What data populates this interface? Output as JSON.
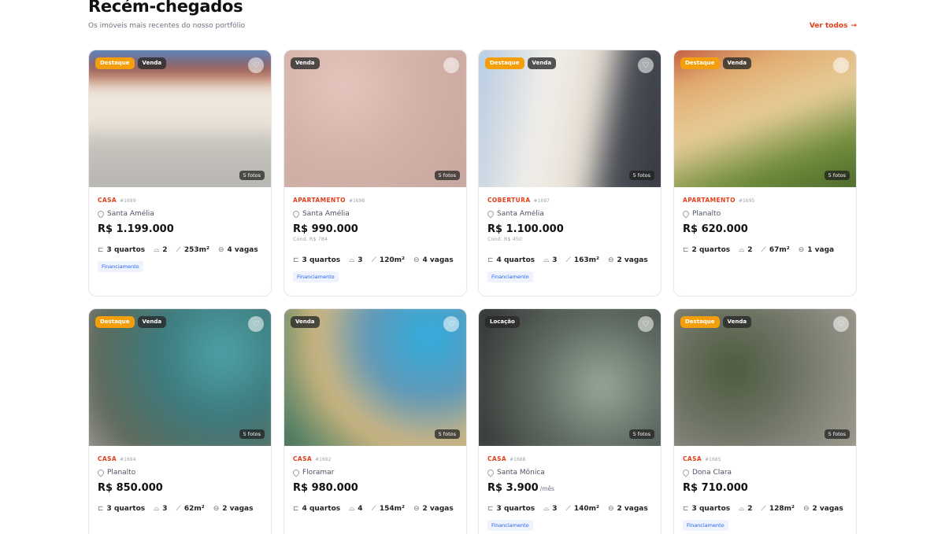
{
  "section": {
    "title": "Recém-chegados",
    "subtitle": "Os imóveis mais recentes do nosso portfólio",
    "see_all": "Ver todos",
    "see_all_icon": "arrow-right-icon"
  },
  "colors": {
    "accent": "#e2401c",
    "badge_featured": "#f59e0b",
    "tag_text": "#2563eb"
  },
  "listings": [
    {
      "badges": [
        "Destaque",
        "Venda"
      ],
      "photos": "5 fotos",
      "type": "CASA",
      "code": "#1699",
      "location": "Santa Amélia",
      "price": "R$ 1.199.000",
      "price_suffix": "",
      "condo": "",
      "bedrooms": "3 quartos",
      "baths": "2",
      "area": "253m²",
      "parking": "4 vagas",
      "tag": "Financiamento"
    },
    {
      "badges": [
        "Venda"
      ],
      "photos": "5 fotos",
      "type": "APARTAMENTO",
      "code": "#1698",
      "location": "Santa Amélia",
      "price": "R$ 990.000",
      "price_suffix": "",
      "condo": "Cond. R$ 784",
      "bedrooms": "3 quartos",
      "baths": "3",
      "area": "120m²",
      "parking": "4 vagas",
      "tag": "Financiamento"
    },
    {
      "badges": [
        "Destaque",
        "Venda"
      ],
      "photos": "5 fotos",
      "type": "COBERTURA",
      "code": "#1697",
      "location": "Santa Amélia",
      "price": "R$ 1.100.000",
      "price_suffix": "",
      "condo": "Cond. R$ 450",
      "bedrooms": "4 quartos",
      "baths": "3",
      "area": "163m²",
      "parking": "2 vagas",
      "tag": "Financiamento"
    },
    {
      "badges": [
        "Destaque",
        "Venda"
      ],
      "photos": "5 fotos",
      "type": "APARTAMENTO",
      "code": "#1695",
      "location": "Planalto",
      "price": "R$ 620.000",
      "price_suffix": "",
      "condo": "",
      "bedrooms": "2 quartos",
      "baths": "2",
      "area": "67m²",
      "parking": "1 vaga",
      "tag": ""
    },
    {
      "badges": [
        "Destaque",
        "Venda"
      ],
      "photos": "5 fotos",
      "type": "CASA",
      "code": "#1694",
      "location": "Planalto",
      "price": "R$ 850.000",
      "price_suffix": "",
      "condo": "",
      "bedrooms": "3 quartos",
      "baths": "3",
      "area": "62m²",
      "parking": "2 vagas",
      "tag": ""
    },
    {
      "badges": [
        "Venda"
      ],
      "photos": "5 fotos",
      "type": "CASA",
      "code": "#1692",
      "location": "Floramar",
      "price": "R$ 980.000",
      "price_suffix": "",
      "condo": "",
      "bedrooms": "4 quartos",
      "baths": "4",
      "area": "154m²",
      "parking": "2 vagas",
      "tag": ""
    },
    {
      "badges": [
        "Locação"
      ],
      "photos": "5 fotos",
      "type": "CASA",
      "code": "#1688",
      "location": "Santa Mônica",
      "price": "R$ 3.900",
      "price_suffix": "/mês",
      "condo": "",
      "bedrooms": "3 quartos",
      "baths": "3",
      "area": "140m²",
      "parking": "2 vagas",
      "tag": "Financiamento"
    },
    {
      "badges": [
        "Destaque",
        "Venda"
      ],
      "photos": "5 fotos",
      "type": "CASA",
      "code": "#1685",
      "location": "Dona Clara",
      "price": "R$ 710.000",
      "price_suffix": "",
      "condo": "",
      "bedrooms": "3 quartos",
      "baths": "2",
      "area": "128m²",
      "parking": "2 vagas",
      "tag": "Financiamento"
    }
  ]
}
